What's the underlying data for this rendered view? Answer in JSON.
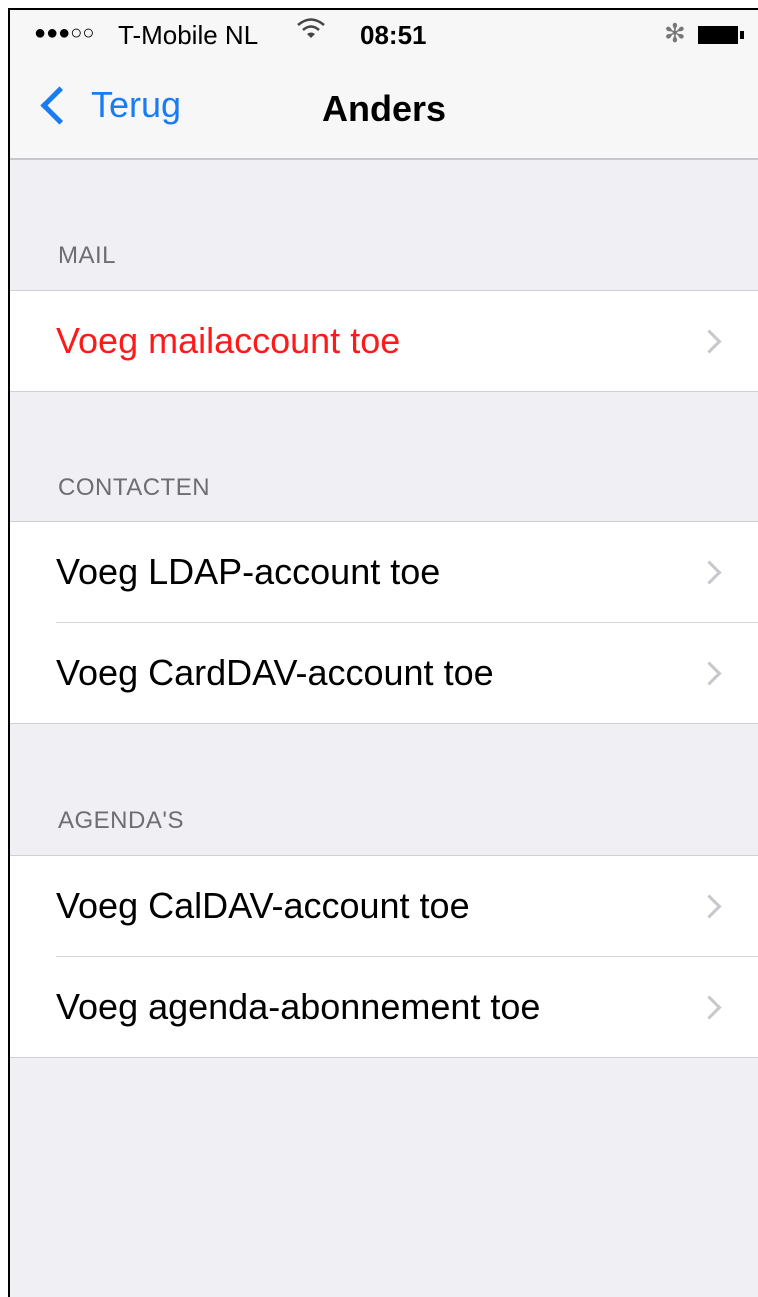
{
  "status_bar": {
    "signal": "●●●○○",
    "carrier": "T-Mobile NL",
    "wifi_icon": "wifi-icon",
    "time": "08:51",
    "bluetooth_icon": "✻",
    "battery_icon": "battery-icon"
  },
  "nav": {
    "back_label": "Terug",
    "title": "Anders"
  },
  "sections": {
    "mail": {
      "header": "MAIL",
      "rows": [
        "Voeg mailaccount toe"
      ]
    },
    "contacts": {
      "header": "CONTACTEN",
      "rows": [
        "Voeg LDAP-account toe",
        "Voeg CardDAV-account toe"
      ]
    },
    "calendars": {
      "header": "AGENDA'S",
      "rows": [
        "Voeg CalDAV-account toe",
        "Voeg agenda-abonnement toe"
      ]
    }
  },
  "colors": {
    "accent": "#1a7cf5",
    "highlight_text": "#ff1a1a",
    "background": "#efeff4"
  }
}
